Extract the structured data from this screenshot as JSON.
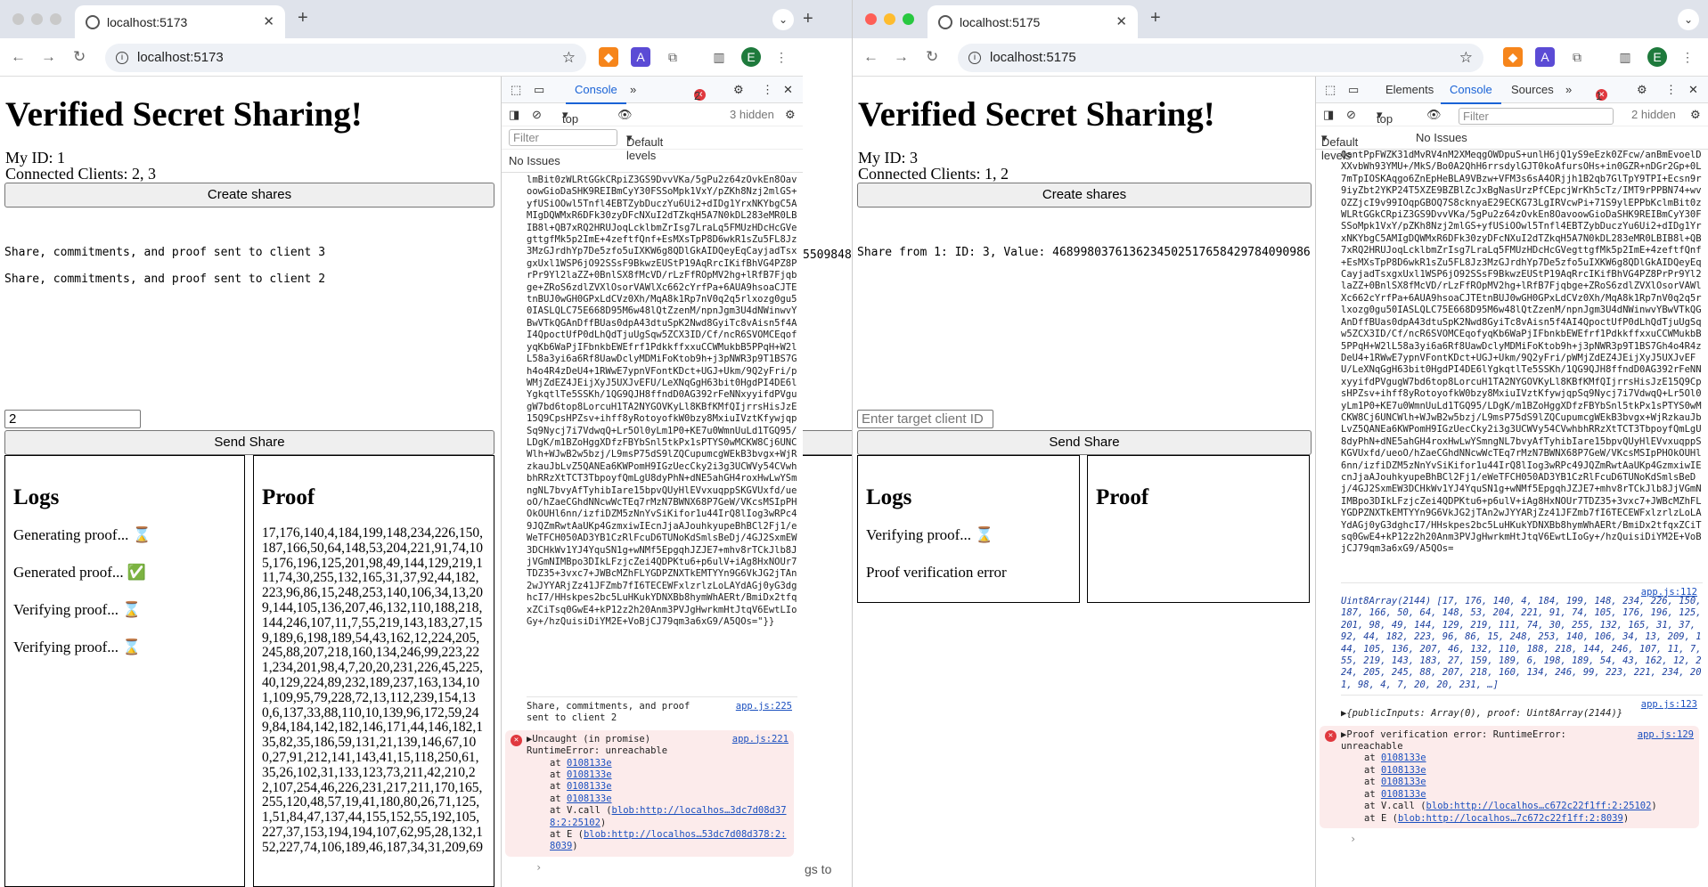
{
  "left_window": {
    "tab_title": "localhost:5173",
    "url": "localhost:5173",
    "page": {
      "title": "Verified Secret Sharing!",
      "my_id": "My ID: 1",
      "connected": "Connected Clients: 2, 3",
      "create_shares_label": "Create shares",
      "messages": [
        "Share, commitments, and proof sent to client 3",
        "Share, commitments, and proof sent to client 2"
      ],
      "target_input_value": "2",
      "send_share_label": "Send Share",
      "logs_title": "Logs",
      "logs": [
        "Generating proof... ⌛",
        "Generated proof... ✅",
        "Verifying proof... ⌛",
        "Verifying proof... ⌛"
      ],
      "proof_title": "Proof",
      "proof_text": "17,176,140,4,184,199,148,234,226,150,187,166,50,64,148,53,204,221,91,74,105,176,196,125,201,98,49,144,129,219,111,74,30,255,132,165,31,37,92,44,182,223,96,86,15,248,253,140,106,34,13,209,144,105,136,207,46,132,110,188,218,144,246,107,11,7,55,219,143,183,27,159,189,6,198,189,54,43,162,12,224,205,245,88,207,218,160,134,246,99,223,221,234,201,98,4,7,20,20,231,226,45,225,40,129,224,89,232,189,237,163,134,101,109,95,79,228,72,13,112,239,154,130,6,137,33,88,110,10,139,96,172,59,249,84,184,142,182,146,171,44,146,182,135,82,35,186,59,131,21,139,146,67,100,27,91,212,141,143,41,15,118,250,61,35,26,102,31,133,123,73,211,42,210,22,107,254,46,226,231,217,211,170,165,255,120,48,57,19,41,180,80,26,71,125,1,51,84,47,137,44,155,152,55,192,105,227,37,153,194,194,107,62,95,28,132,152,227,74,106,189,46,187,34,31,209,69"
    },
    "devtools": {
      "tabs": [
        "Console"
      ],
      "error_count": "2",
      "context": "top",
      "hidden": "3 hidden",
      "filter_placeholder": "Filter",
      "levels": "Default levels",
      "issues": "No Issues",
      "blob": "lmBit0zWLRtGGkCRpiZ3GS9DvvVKa/5gPu2z64zOvkEn8OavoowGioDaSHK9REIBmCyY30FSSoMpk1VxY/pZKh8Nzj2mlGS+yfUSiOOwl5Tnfl4EBTZybDuczYu6Ui2+dIDg1YrxNKYbgC5AMIgDQWMxR6DFk30zyDFcNXuI2dTZkqH5A7N0kDL283eMR0LBIB8l+QB7xRQ2HRUJoqLcklbmZrIsg7LraLq5FMUzHDcHcGVegttgfMk5p2ImE+4zeftfQnf+EsMXsTpP8D6wkR1sZu5FL8Jz3MzGJrdhYp7De5zfo5uIXKW6g8QDlGkAIDQeyEqCayjadTsxgxUxl1WSP6jO92SSsF9BkwzEUStP19AqRrcIKifBhVG4PZ8PrPr9Yl2laZZ+0BnlSX8fMcVD/rLzFfROpMV2hg+lRfB7Fjqbge+ZRoS6zdlZVXlOsorVAWlXc662cYrfPa+6AUA9hsoaCJTEtnBUJ0wGH0GPxLdCVz0Xh/MqA8k1Rp7nV0q2q5rlxozg0gu50IASLQLC75E668D95M6w48lQtZzenM/npnJgm3U4dNWinwvYBwVTkQGAnDffBUas0dpA43dtuSpK2Nwd8GyiTc8vAisn5f4AI4QpoctUfP0dLhQdTjuUgSqw5ZCX3ID/Cf/ncR6SVOMCEqofyqKb6WaPjIFbnkbEWEfrf1PdkkffxxuCCWMukbB5PPqH+W2lL58a3yi6a6Rf8UawDclyMDMiFoKtob9h+j3pNWR3p9T1BS7Gh4o4R4zDeU4+1RWwE7ypnVFontKDct+UGJ+Ukm/9Q2yFri/pWMjZdEZ4JEijXyJ5UXJvEFU/LeXNqGgH63bit0HgdPI4DE6lYgkqtlTe5SSKh/1QG9QJH8ffndD0AG392rFeNNxyyifdPVgugW7bd6top8LorcuH1TA2NYGOVKyLl8KBfKMfQIjrrsHisJzE15Q9CpsHPZsv+ihff8yRotoyofkW0bzy8MxiuIVztKfywjqpSq9Nycj7i7VdwqQ+Lr5Ol0yLm1P0+KE7u0WmnUuLd1TGQ95/LDgK/m1BZoHggXDfzFBYbSnl5tkPx1sPTYS0wMCKW8Cj6UNCWlh+WJwB2w5bzj/L9msP75dS9lZQCupumcgWEkB3bvgx+WjRzkauJbLvZ5QANEa6KWPomH9IGzUecCky2i3g3UCWVy54CVwhbhRRzXtTCT3TbpoyfQmLgU8dyPhN+dNE5ahGH4roxHwLwYSmngNL7bvyAfTyhibIare15bpvQUyHlEVvxuqppSKGVUxfd/ueoO/hZaeCGhdNNcwWcTEq7rMzN7BWNX68P7GeW/VKcsMSIpPHOkOUHl6nn/izfiDZM5zNnYvSiKifor1u44IrQ8lIog3wRPc49JQZmRwtAaUKp4GzmxiwIEcnJjaAJouhkyupeBhBCl2Fj1/eWeTFCH050AD3YB1CzRlFcuD6TUNoKdSmlsBeDj/4GJ2SxmEW3DCHkWv1YJ4YquSN1g+wNMf5EpgqhJZJE7+mhv8rTCkJlb8JjVGmNIMBpo3DIkLFzjcZei4QDPKtu6+p6ulV+iAg8HxNOUr7TDZ35+3vxc7+JWBcMZhFLYGDPZNXTkEMTYYn9G6VkJG2jTAn2wJYYARjZz41JFZmb7fI6TECEWFxlzrlzLoLAYdAGj0yG3dghcI7/HHskpes2bc5LuHKukYDNXBb8hymWhAERt/BmiDx2tfqxZCiTsq0GwE4+kP12z2h20Anm3PVJgHwrkmHtJtqV6EwtLIoGy+/hzQuisiDiYM2E+VoBjCJ79qm3a6xG9/A5QOs=\"}}",
      "log_share2": "Share, commitments, and proof sent to client 2",
      "log_share2_src": "app.js:225",
      "error_title": "Uncaught (in promise)",
      "error_src": "app.js:221",
      "error_msg": "RuntimeError: unreachable",
      "stack": [
        "0108133e",
        "0108133e",
        "0108133e",
        "0108133e"
      ],
      "stack_vcall_link": "blob:http://localhos…3dc7d08d378:2:25102",
      "stack_e_link": "blob:http://localhos…53dc7d08d378:2:8039"
    }
  },
  "background_window": {
    "fragment_1": "5509848",
    "fragment_2": "gs to"
  },
  "right_window": {
    "tab_title": "localhost:5175",
    "url": "localhost:5175",
    "page": {
      "title": "Verified Secret Sharing!",
      "my_id": "My ID: 3",
      "connected": "Connected Clients: 1, 2",
      "create_shares_label": "Create shares",
      "share_message": "Share from 1: ID: 3, Value: 4689980376136234502517658429784090986",
      "target_input_placeholder": "Enter target client ID",
      "send_share_label": "Send Share",
      "logs_title": "Logs",
      "logs": [
        "Verifying proof... ⌛",
        "Proof verification error"
      ],
      "proof_title": "Proof"
    },
    "devtools": {
      "tabs": [
        "Elements",
        "Console",
        "Sources"
      ],
      "active_tab": "Console",
      "error_count": "1",
      "context": "top",
      "hidden": "2 hidden",
      "filter_placeholder": "Filter",
      "levels": "Default levels",
      "issues": "No Issues",
      "blob": "QantPpFWZK31dMvRV4nM2XMeqgOWDpuS+unlH6jQ1yS9eEzk0ZFcw/anBmEvoelDXXvbWh93YMU+/MkS/Bo0A2QhH6rrsdylGJT0koAfursOHs+in0GZR+nDGr2Gp+0L7mTpIOSKAqgo6ZnEpHeBLA9VBzw+VFM3s6sA4ORjjh1B2qb7GlTpY9TPI+Ecsn9r9iyZbt2YKP24T5XZE9BZBlZcJxBgNasUrzPfCEpcjWrKh5cTz/IMT9rPPBN74+wvOZZjcI9v99IOqpGBOQ7S8cknyaE29ECKG73LgIRVcwPi+71S9ylEPPbKclmBit0zWLRtGGkCRpiZ3GS9DvvVKa/5gPu2z64zOvkEn8OavoowGioDaSHK9REIBmCyY30FSSoMpk1VxY/pZKh8Nzj2mlGS+yfUSiOOwl5Tnfl4EBTZybDuczYu6Ui2+dIDg1YrxNKYbgC5AMIgDQWMxR6DFk30zyDFcNXuI2dTZkqH5A7N0kDL283eMR0LBIB8l+QB7xRQ2HRUJoqLcklbmZrIsg7LraLq5FMUzHDcHcGVegttgfMk5p2ImE+4zeftfQnf+EsMXsTpP8D6wkR1sZu5FL8Jz3MzGJrdhYp7De5zfo5uIXKW6g8QDlGkAIDQeyEqCayjadTsxgxUxl1WSP6jO92SSsF9BkwzEUStP19AqRrcIKifBhVG4PZ8PrPr9Yl2laZZ+0BnlSX8fMcVD/rLzFfROpMV2hg+lRfB7Fjqbge+ZRoS6zdlZVXlOsorVAWlXc662cYrfPa+6AUA9hsoaCJTEtnBUJ0wGH0GPxLdCVz0Xh/MqA8k1Rp7nV0q2q5rlxozg0gu50IASLQLC75E668D95M6w48lQtZzenM/npnJgm3U4dNWinwvYBwVTkQGAnDffBUas0dpA43dtuSpK2Nwd8GyiTc8vAisn5f4AI4QpoctUfP0dLhQdTjuUgSqw5ZCX3ID/Cf/ncR6SVOMCEqofyqKb6WaPjIFbnkbEWEfrf1PdkkffxxuCCWMukbB5PPqH+W2lL58a3yi6a6Rf8UawDclyMDMiFoKtob9h+j3pNWR3p9T1BS7Gh4o4R4zDeU4+1RWwE7ypnVFontKDct+UGJ+Ukm/9Q2yFri/pWMjZdEZ4JEijXyJ5UXJvEFU/LeXNqGgH63bit0HgdPI4DE6lYgkqtlTe5SSKh/1QG9QJH8ffndD0AG392rFeNNxyyifdPVgugW7bd6top8LorcuH1TA2NYGOVKyLl8KBfKMfQIjrrsHisJzE15Q9CpsHPZsv+ihff8yRotoyofkW0bzy8MxiuIVztKfywjqpSq9Nycj7i7VdwqQ+Lr5Ol0yLm1P0+KE7u0WmnUuLd1TGQ95/LDgK/m1BZoHggXDfzFBYbSnl5tkPx1sPTYS0wMCKW8Cj6UNCWlh+WJwB2w5bzj/L9msP75dS9lZQCupumcgWEkB3bvgx+WjRzkauJbLvZ5QANEa6KWPomH9IGzUecCky2i3g3UCWVy54CVwhbhRRzXtTCT3TbpoyfQmLgU8dyPhN+dNE5ahGH4roxHwLwYSmngNL7bvyAfTyhibIare15bpvQUyHlEVvxuqppSKGVUxfd/ueoO/hZaeCGhdNNcwWcTEq7rMzN7BWNX68P7GeW/VKcsMSIpPHOkOUHl6nn/izfiDZM5zNnYvSiKifor1u44IrQ8lIog3wRPc49JQZmRwtAaUKp4GzmxiwIEcnJjaAJouhkyupeBhBCl2Fj1/eWeTFCH050AD3YB1CzRlFcuD6TUNoKdSmlsBeDj/4GJ2SxmEW3DCHkWv1YJ4YquSN1g+wNMf5EpgqhJZJE7+mhv8rTCkJlb8JjVGmNIMBpo3DIkLFzjcZei4QDPKtu6+p6ulV+iAg8HxNOUr7TDZ35+3vxc7+JWBcMZhFLYGDPZNXTkEMTYYn9G6VkJG2jTAn2wJYYARjZz41JFZmb7fI6TECEWFxlzrlzLoLAYdAGj0yG3dghcI7/HHskpes2bc5LuHKukYDNXBb8hymWhAERt/BmiDx2tfqxZCiTsq0GwE4+kP12z2h20Anm3PVJgHwrkmHtJtqV6EwtLIoGy+/hzQuisiDiYM2E+VoBjCJ79qm3a6xG9/A5QOs=",
      "uint8_src": "app.js:112",
      "uint8_text": "Uint8Array(2144) [17, 176, 140, 4, 184, 199, 148, 234, 226, 150, 187, 166, 50, 64, 148, 53, 204, 221, 91, 74, 105, 176, 196, 125, 201, 98, 49, 144, 129, 219, 111, 74, 30, 255, 132, 165, 31, 37, 92, 44, 182, 223, 96, 86, 15, 248, 253, 140, 106, 34, 13, 209, 144, 105, 136, 207, 46, 132, 110, 188, 218, 144, 246, 107, 11, 7, 55, 219, 143, 183, 27, 159, 189, 6, 198, 189, 54, 43, 162, 12, 224, 205, 245, 88, 207, 218, 160, 134, 246, 99, 223, 221, 234, 201, 98, 4, 7, 20, 20, 231, …]",
      "obj_src": "app.js:123",
      "obj_text": "{publicInputs: Array(0), proof: Uint8Array(2144)}",
      "error_title": "Proof verification error: RuntimeError: unreachable",
      "error_src": "app.js:129",
      "stack": [
        "0108133e",
        "0108133e",
        "0108133e",
        "0108133e"
      ],
      "stack_vcall_link": "blob:http://localhos…c672c22f1ff:2:25102",
      "stack_e_link": "blob:http://localhos…7c672c22f1ff:2:8039"
    }
  },
  "colors": {
    "accent": "#1a63d6",
    "error": "#e0383e",
    "error_bg": "#fcebeb",
    "link": "#1a4fbf"
  }
}
